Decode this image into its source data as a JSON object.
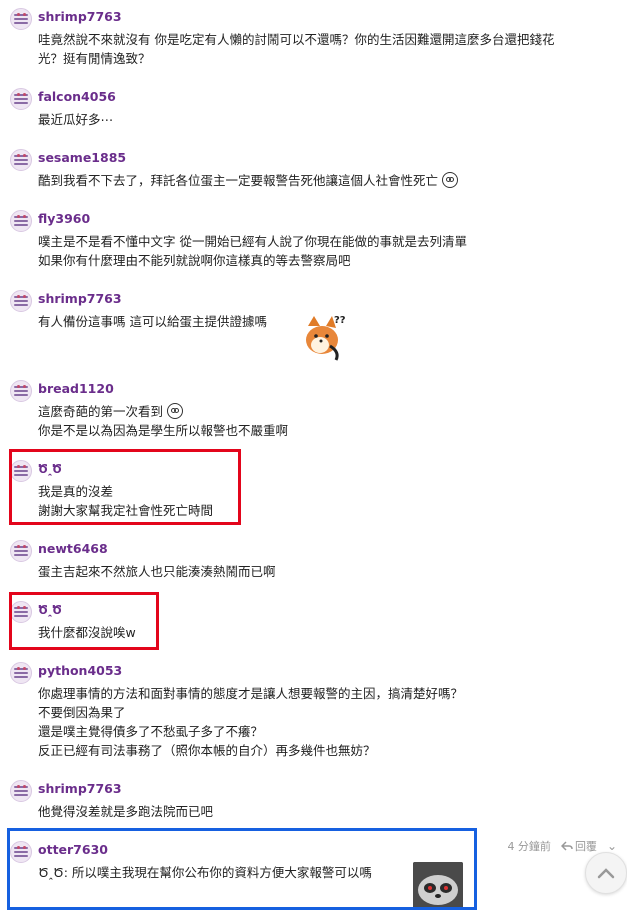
{
  "comments": [
    {
      "user": "shrimp7763",
      "lines": [
        "哇竟然說不來就沒有 你是吃定有人懶的討鬧可以不還嗎？你的生活因難還開這麼多台還把錢花",
        "光？挺有閒情逸致？"
      ]
    },
    {
      "user": "falcon4056",
      "lines": [
        "最近瓜好多⋯"
      ]
    },
    {
      "user": "sesame1885",
      "lines": [
        "酷到我看不下去了，拜託各位蛋主一定要報警告死他讓這個人社會性死亡"
      ]
    },
    {
      "user": "fly3960",
      "lines": [
        "噗主是不是看不懂中文字 從一開始已經有人說了你現在能做的事就是去列清單",
        "如果你有什麼理由不能列就說啊你這樣真的等去警察局吧"
      ]
    },
    {
      "user": "shrimp7763",
      "lines": [
        "有人備份這事嗎 這可以給蛋主提供證據嗎"
      ]
    },
    {
      "user": "bread1120",
      "lines": [
        "這麼奇葩的第一次看到",
        "你是不是以為因為是學生所以報警也不嚴重啊"
      ]
    },
    {
      "user": "ԾꞈԾ",
      "lines": [
        "我是真的沒差",
        "謝謝大家幫我定社會性死亡時間"
      ]
    },
    {
      "user": "newt6468",
      "lines": [
        "蛋主吉起來不然旅人也只能湊湊熱鬧而已啊"
      ]
    },
    {
      "user": "ԾꞈԾ",
      "lines": [
        "我什麼都沒說唉w"
      ]
    },
    {
      "user": "python4053",
      "lines": [
        "你處理事情的方法和面對事情的態度才是讓人想要報警的主因，搞清楚好嗎？",
        "不要倒因為果了",
        "還是噗主覺得債多了不愁虱子多了不癢？",
        "反正已經有司法事務了（照你本帳的自介）再多幾件也無妨？"
      ]
    },
    {
      "user": "shrimp7763",
      "lines": [
        "他覺得沒差就是多跑法院而已吧"
      ]
    },
    {
      "user": "otter7630",
      "lines": [
        "ԾꞈԾ: 所以噗主我現在幫你公布你的資料方便大家報警可以嗎"
      ]
    }
  ],
  "last_meta": {
    "time": "4 分鐘前",
    "reply": "回覆"
  },
  "colors": {
    "username": "#6a2d8b",
    "highlight_red": "#e3051b",
    "highlight_blue": "#1660e0"
  }
}
